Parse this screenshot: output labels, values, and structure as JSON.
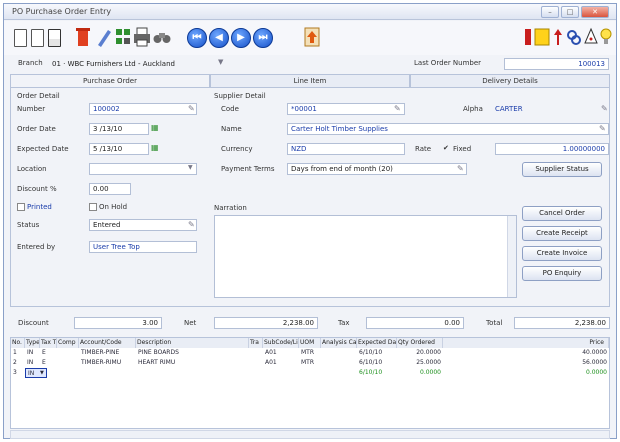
{
  "window": {
    "title": "PO Purchase Order Entry"
  },
  "toolbar": {
    "icons": [
      "new-doc-icon",
      "open-doc-icon",
      "save-doc-icon",
      "delete-icon",
      "edit-icon",
      "grid-icon",
      "print-icon",
      "binoculars-icon",
      "first-record-icon",
      "previous-record-icon",
      "next-record-icon",
      "last-record-icon",
      "export-icon",
      "notes-icon",
      "flag-icon",
      "link-icon",
      "alert-icon",
      "hint-icon"
    ],
    "nav_glyphs": {
      "first": "⏮",
      "prev": "◀",
      "next": "▶",
      "last": "⏭"
    }
  },
  "branch": {
    "label": "Branch",
    "value": "01 · WBC Furnishers Ltd - Auckland",
    "last_order_label": "Last Order Number",
    "last_order_value": "100013"
  },
  "tabs": [
    "Purchase Order",
    "Line Item",
    "Delivery Details"
  ],
  "order_detail": {
    "heading": "Order Detail",
    "number_label": "Number",
    "number": "100002",
    "order_date_label": "Order Date",
    "order_date": "3 /13/10",
    "expected_date_label": "Expected Date",
    "expected_date": "5 /13/10",
    "location_label": "Location",
    "location": "",
    "discount_label": "Discount %",
    "discount": "0.00",
    "printed_label": "Printed",
    "on_hold_label": "On Hold",
    "status_label": "Status",
    "status": "Entered",
    "entered_by_label": "Entered by",
    "entered_by": "User Tree Top"
  },
  "supplier_detail": {
    "heading": "Supplier Detail",
    "code_label": "Code",
    "code": "*00001",
    "alpha_label": "Alpha",
    "alpha": "CARTER",
    "name_label": "Name",
    "name": "Carter Holt Timber Supplies",
    "currency_label": "Currency",
    "currency": "NZD",
    "rate_label": "Rate",
    "fixed_label": "Fixed",
    "fixed_mark": "✔",
    "rate": "1.00000000",
    "payment_terms_label": "Payment Terms",
    "payment_terms": "Days from end of month (20)"
  },
  "narration_label": "Narration",
  "buttons": {
    "supplier_status": "Supplier Status",
    "cancel_order": "Cancel Order",
    "create_receipt": "Create Receipt",
    "create_invoice": "Create Invoice",
    "po_enquiry": "PO Enquiry"
  },
  "totals": {
    "discount_label": "Discount",
    "discount": "3.00",
    "net_label": "Net",
    "net": "2,238.00",
    "tax_label": "Tax",
    "tax": "0.00",
    "total_label": "Total",
    "total": "2,238.00"
  },
  "grid": {
    "columns": [
      "No.",
      "Type",
      "Tax T",
      "Comp",
      "Account/Code",
      "Description",
      "Tra",
      "SubCode/Li",
      "UOM",
      "Analysis Cat",
      "Expected Date",
      "Qty Ordered",
      "Price"
    ],
    "rows": [
      {
        "no": "1",
        "type": "IN",
        "tax": "E",
        "comp": "",
        "account": "TIMBER-PINE",
        "desc": "PINE BOARDS",
        "tra": "",
        "sub": "A01",
        "uom": "MTR",
        "an": "",
        "exp": "6/10/10",
        "qty": "20.0000",
        "price": "40.0000"
      },
      {
        "no": "2",
        "type": "IN",
        "tax": "E",
        "comp": "",
        "account": "TIMBER-RIMU",
        "desc": "HEART RIMU",
        "tra": "",
        "sub": "A01",
        "uom": "MTR",
        "an": "",
        "exp": "6/10/10",
        "qty": "25.0000",
        "price": "56.0000"
      },
      {
        "no": "3",
        "type": "IN",
        "tax": "",
        "comp": "",
        "account": "",
        "desc": "",
        "tra": "",
        "sub": "",
        "uom": "",
        "an": "",
        "exp": "6/10/10",
        "qty": "0.0000",
        "price": "0.0000"
      }
    ]
  },
  "colors": {
    "accent_blue": "#1a3caa",
    "new_row_green": "#1b8f1b"
  }
}
